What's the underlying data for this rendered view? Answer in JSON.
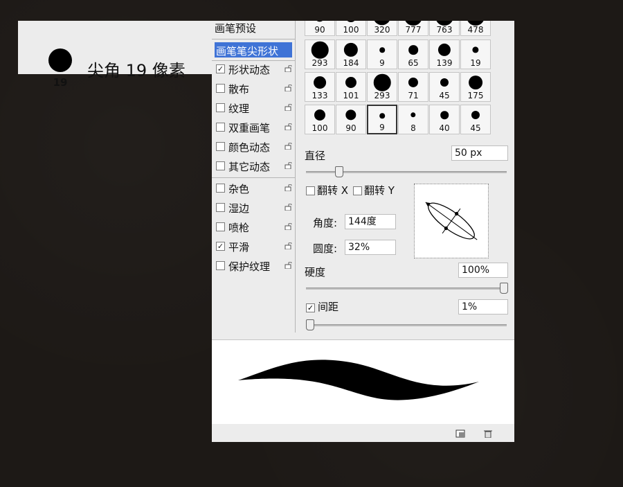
{
  "tip_preview": {
    "size": "19",
    "name": "尖角 19 像素"
  },
  "options": {
    "preset_label": "画笔预设",
    "tip_shape_label": "画笔笔尖形状",
    "items": [
      {
        "label": "形状动态",
        "checked": true
      },
      {
        "label": "散布",
        "checked": false
      },
      {
        "label": "纹理",
        "checked": false
      },
      {
        "label": "双重画笔",
        "checked": false
      },
      {
        "label": "颜色动态",
        "checked": false
      },
      {
        "label": "其它动态",
        "checked": false
      },
      {
        "label": "杂色",
        "checked": false
      },
      {
        "label": "湿边",
        "checked": false
      },
      {
        "label": "喷枪",
        "checked": false
      },
      {
        "label": "平滑",
        "checked": true
      },
      {
        "label": "保护纹理",
        "checked": false
      }
    ]
  },
  "brush_grid": {
    "rows": [
      [
        "90",
        "100",
        "320",
        "777",
        "763",
        "478"
      ],
      [
        "293",
        "184",
        "9",
        "65",
        "139",
        "19"
      ],
      [
        "133",
        "101",
        "293",
        "71",
        "45",
        "175"
      ],
      [
        "100",
        "90",
        "9",
        "8",
        "40",
        "45"
      ]
    ],
    "selected_row": 3,
    "selected_col": 2
  },
  "settings": {
    "diameter_label": "直径",
    "diameter_value": "50 px",
    "diameter_slider": 0.15,
    "flip_x_label": "翻转 X",
    "flip_y_label": "翻转 Y",
    "angle_label": "角度:",
    "angle_value": "144度",
    "roundness_label": "圆度:",
    "roundness_value": "32%",
    "hardness_label": "硬度",
    "hardness_value": "100%",
    "hardness_slider": 1.0,
    "spacing_label": "间距",
    "spacing_checked": true,
    "spacing_value": "1%",
    "spacing_slider": 0.0
  },
  "icons": {
    "check": "✓",
    "scroll_up": "▲",
    "scroll_down": "▼"
  }
}
